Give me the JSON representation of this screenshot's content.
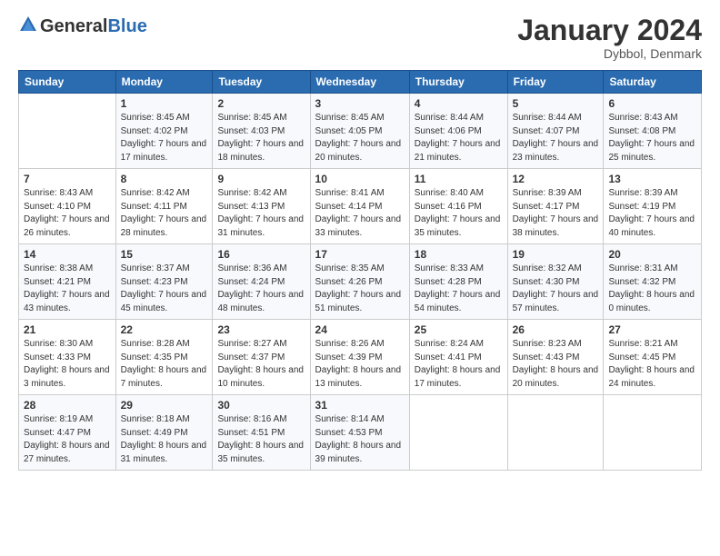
{
  "header": {
    "logo_general": "General",
    "logo_blue": "Blue",
    "cal_title": "January 2024",
    "cal_subtitle": "Dybbol, Denmark"
  },
  "days_of_week": [
    "Sunday",
    "Monday",
    "Tuesday",
    "Wednesday",
    "Thursday",
    "Friday",
    "Saturday"
  ],
  "weeks": [
    [
      {
        "day": "",
        "sunrise": "",
        "sunset": "",
        "daylight": ""
      },
      {
        "day": "1",
        "sunrise": "Sunrise: 8:45 AM",
        "sunset": "Sunset: 4:02 PM",
        "daylight": "Daylight: 7 hours and 17 minutes."
      },
      {
        "day": "2",
        "sunrise": "Sunrise: 8:45 AM",
        "sunset": "Sunset: 4:03 PM",
        "daylight": "Daylight: 7 hours and 18 minutes."
      },
      {
        "day": "3",
        "sunrise": "Sunrise: 8:45 AM",
        "sunset": "Sunset: 4:05 PM",
        "daylight": "Daylight: 7 hours and 20 minutes."
      },
      {
        "day": "4",
        "sunrise": "Sunrise: 8:44 AM",
        "sunset": "Sunset: 4:06 PM",
        "daylight": "Daylight: 7 hours and 21 minutes."
      },
      {
        "day": "5",
        "sunrise": "Sunrise: 8:44 AM",
        "sunset": "Sunset: 4:07 PM",
        "daylight": "Daylight: 7 hours and 23 minutes."
      },
      {
        "day": "6",
        "sunrise": "Sunrise: 8:43 AM",
        "sunset": "Sunset: 4:08 PM",
        "daylight": "Daylight: 7 hours and 25 minutes."
      }
    ],
    [
      {
        "day": "7",
        "sunrise": "Sunrise: 8:43 AM",
        "sunset": "Sunset: 4:10 PM",
        "daylight": "Daylight: 7 hours and 26 minutes."
      },
      {
        "day": "8",
        "sunrise": "Sunrise: 8:42 AM",
        "sunset": "Sunset: 4:11 PM",
        "daylight": "Daylight: 7 hours and 28 minutes."
      },
      {
        "day": "9",
        "sunrise": "Sunrise: 8:42 AM",
        "sunset": "Sunset: 4:13 PM",
        "daylight": "Daylight: 7 hours and 31 minutes."
      },
      {
        "day": "10",
        "sunrise": "Sunrise: 8:41 AM",
        "sunset": "Sunset: 4:14 PM",
        "daylight": "Daylight: 7 hours and 33 minutes."
      },
      {
        "day": "11",
        "sunrise": "Sunrise: 8:40 AM",
        "sunset": "Sunset: 4:16 PM",
        "daylight": "Daylight: 7 hours and 35 minutes."
      },
      {
        "day": "12",
        "sunrise": "Sunrise: 8:39 AM",
        "sunset": "Sunset: 4:17 PM",
        "daylight": "Daylight: 7 hours and 38 minutes."
      },
      {
        "day": "13",
        "sunrise": "Sunrise: 8:39 AM",
        "sunset": "Sunset: 4:19 PM",
        "daylight": "Daylight: 7 hours and 40 minutes."
      }
    ],
    [
      {
        "day": "14",
        "sunrise": "Sunrise: 8:38 AM",
        "sunset": "Sunset: 4:21 PM",
        "daylight": "Daylight: 7 hours and 43 minutes."
      },
      {
        "day": "15",
        "sunrise": "Sunrise: 8:37 AM",
        "sunset": "Sunset: 4:23 PM",
        "daylight": "Daylight: 7 hours and 45 minutes."
      },
      {
        "day": "16",
        "sunrise": "Sunrise: 8:36 AM",
        "sunset": "Sunset: 4:24 PM",
        "daylight": "Daylight: 7 hours and 48 minutes."
      },
      {
        "day": "17",
        "sunrise": "Sunrise: 8:35 AM",
        "sunset": "Sunset: 4:26 PM",
        "daylight": "Daylight: 7 hours and 51 minutes."
      },
      {
        "day": "18",
        "sunrise": "Sunrise: 8:33 AM",
        "sunset": "Sunset: 4:28 PM",
        "daylight": "Daylight: 7 hours and 54 minutes."
      },
      {
        "day": "19",
        "sunrise": "Sunrise: 8:32 AM",
        "sunset": "Sunset: 4:30 PM",
        "daylight": "Daylight: 7 hours and 57 minutes."
      },
      {
        "day": "20",
        "sunrise": "Sunrise: 8:31 AM",
        "sunset": "Sunset: 4:32 PM",
        "daylight": "Daylight: 8 hours and 0 minutes."
      }
    ],
    [
      {
        "day": "21",
        "sunrise": "Sunrise: 8:30 AM",
        "sunset": "Sunset: 4:33 PM",
        "daylight": "Daylight: 8 hours and 3 minutes."
      },
      {
        "day": "22",
        "sunrise": "Sunrise: 8:28 AM",
        "sunset": "Sunset: 4:35 PM",
        "daylight": "Daylight: 8 hours and 7 minutes."
      },
      {
        "day": "23",
        "sunrise": "Sunrise: 8:27 AM",
        "sunset": "Sunset: 4:37 PM",
        "daylight": "Daylight: 8 hours and 10 minutes."
      },
      {
        "day": "24",
        "sunrise": "Sunrise: 8:26 AM",
        "sunset": "Sunset: 4:39 PM",
        "daylight": "Daylight: 8 hours and 13 minutes."
      },
      {
        "day": "25",
        "sunrise": "Sunrise: 8:24 AM",
        "sunset": "Sunset: 4:41 PM",
        "daylight": "Daylight: 8 hours and 17 minutes."
      },
      {
        "day": "26",
        "sunrise": "Sunrise: 8:23 AM",
        "sunset": "Sunset: 4:43 PM",
        "daylight": "Daylight: 8 hours and 20 minutes."
      },
      {
        "day": "27",
        "sunrise": "Sunrise: 8:21 AM",
        "sunset": "Sunset: 4:45 PM",
        "daylight": "Daylight: 8 hours and 24 minutes."
      }
    ],
    [
      {
        "day": "28",
        "sunrise": "Sunrise: 8:19 AM",
        "sunset": "Sunset: 4:47 PM",
        "daylight": "Daylight: 8 hours and 27 minutes."
      },
      {
        "day": "29",
        "sunrise": "Sunrise: 8:18 AM",
        "sunset": "Sunset: 4:49 PM",
        "daylight": "Daylight: 8 hours and 31 minutes."
      },
      {
        "day": "30",
        "sunrise": "Sunrise: 8:16 AM",
        "sunset": "Sunset: 4:51 PM",
        "daylight": "Daylight: 8 hours and 35 minutes."
      },
      {
        "day": "31",
        "sunrise": "Sunrise: 8:14 AM",
        "sunset": "Sunset: 4:53 PM",
        "daylight": "Daylight: 8 hours and 39 minutes."
      },
      {
        "day": "",
        "sunrise": "",
        "sunset": "",
        "daylight": ""
      },
      {
        "day": "",
        "sunrise": "",
        "sunset": "",
        "daylight": ""
      },
      {
        "day": "",
        "sunrise": "",
        "sunset": "",
        "daylight": ""
      }
    ]
  ]
}
